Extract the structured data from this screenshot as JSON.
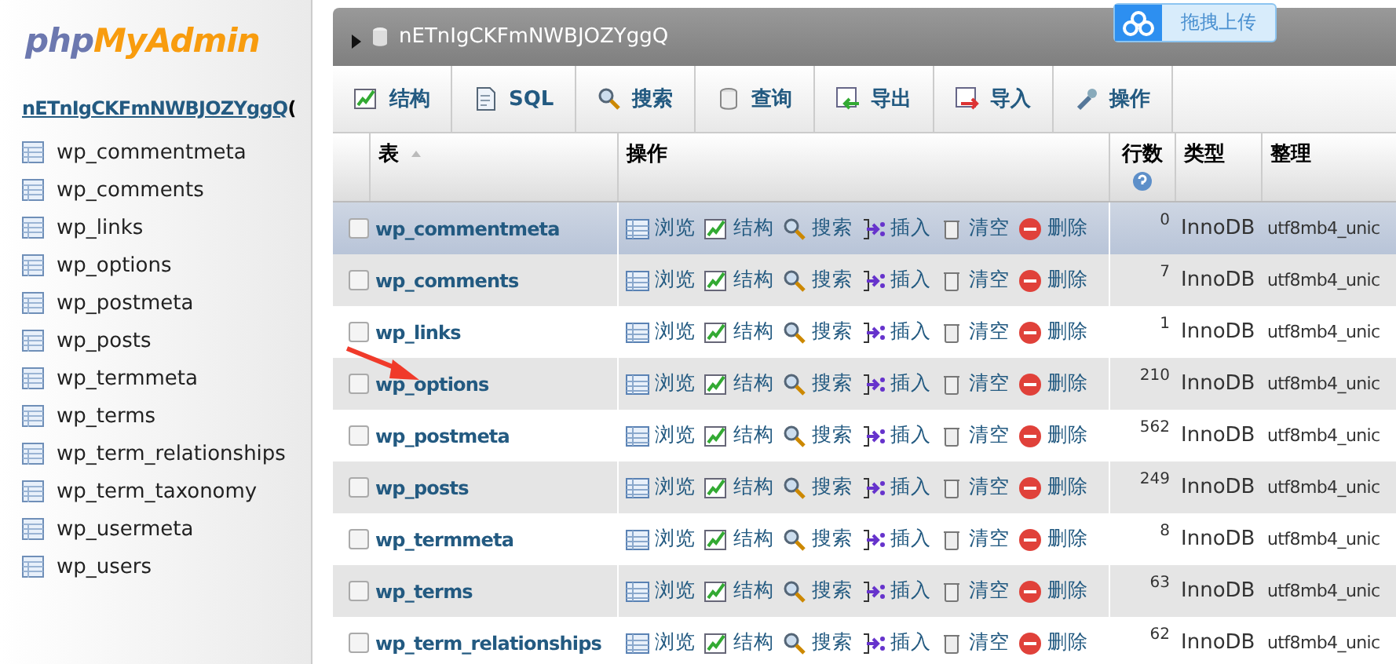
{
  "sidebar": {
    "logo": {
      "part_1": "php",
      "part_2": "MyAdmin"
    },
    "database_link": "nETnIgCKFmNWBJOZYggQ",
    "database_suffix": "(",
    "items": [
      "wp_commentmeta",
      "wp_comments",
      "wp_links",
      "wp_options",
      "wp_postmeta",
      "wp_posts",
      "wp_termmeta",
      "wp_terms",
      "wp_term_relationships",
      "wp_term_taxonomy",
      "wp_usermeta",
      "wp_users"
    ]
  },
  "breadcrumb": {
    "database": "nETnIgCKFmNWBJOZYggQ"
  },
  "upload_badge": {
    "label": "拖拽上传"
  },
  "tabs": [
    {
      "kind": "structure",
      "label": "结构"
    },
    {
      "kind": "sql",
      "label": "SQL"
    },
    {
      "kind": "search",
      "label": "搜索"
    },
    {
      "kind": "query",
      "label": "查询"
    },
    {
      "kind": "export",
      "label": "导出"
    },
    {
      "kind": "import",
      "label": "导入"
    },
    {
      "kind": "operations",
      "label": "操作"
    }
  ],
  "table": {
    "columns": [
      "表",
      "操作",
      "行数",
      "类型",
      "整理"
    ],
    "rows": [
      {
        "name": "wp_commentmeta",
        "highlighted": true,
        "checked": false,
        "actions": [
          {
            "kind": "browse",
            "label": "浏览"
          },
          {
            "kind": "structure",
            "label": "结构"
          },
          {
            "kind": "search",
            "label": "搜索"
          },
          {
            "kind": "insert",
            "label": "插入"
          },
          {
            "kind": "empty",
            "label": "清空"
          },
          {
            "kind": "drop",
            "label": "删除"
          }
        ],
        "rows": "0",
        "type": "InnoDB",
        "collation": "utf8mb4_unic"
      },
      {
        "name": "wp_comments",
        "highlighted": false,
        "checked": false,
        "actions": [
          {
            "kind": "browse",
            "label": "浏览"
          },
          {
            "kind": "structure",
            "label": "结构"
          },
          {
            "kind": "search",
            "label": "搜索"
          },
          {
            "kind": "insert",
            "label": "插入"
          },
          {
            "kind": "empty",
            "label": "清空"
          },
          {
            "kind": "drop",
            "label": "删除"
          }
        ],
        "rows": "7",
        "type": "InnoDB",
        "collation": "utf8mb4_unic"
      },
      {
        "name": "wp_links",
        "highlighted": false,
        "checked": false,
        "actions": [
          {
            "kind": "browse",
            "label": "浏览"
          },
          {
            "kind": "structure",
            "label": "结构"
          },
          {
            "kind": "search",
            "label": "搜索"
          },
          {
            "kind": "insert",
            "label": "插入"
          },
          {
            "kind": "empty",
            "label": "清空"
          },
          {
            "kind": "drop",
            "label": "删除"
          }
        ],
        "rows": "1",
        "type": "InnoDB",
        "collation": "utf8mb4_unic"
      },
      {
        "name": "wp_options",
        "highlighted": false,
        "checked": false,
        "actions": [
          {
            "kind": "browse",
            "label": "浏览"
          },
          {
            "kind": "structure",
            "label": "结构"
          },
          {
            "kind": "search",
            "label": "搜索"
          },
          {
            "kind": "insert",
            "label": "插入"
          },
          {
            "kind": "empty",
            "label": "清空"
          },
          {
            "kind": "drop",
            "label": "删除"
          }
        ],
        "rows": "210",
        "type": "InnoDB",
        "collation": "utf8mb4_unic"
      },
      {
        "name": "wp_postmeta",
        "highlighted": false,
        "checked": false,
        "actions": [
          {
            "kind": "browse",
            "label": "浏览"
          },
          {
            "kind": "structure",
            "label": "结构"
          },
          {
            "kind": "search",
            "label": "搜索"
          },
          {
            "kind": "insert",
            "label": "插入"
          },
          {
            "kind": "empty",
            "label": "清空"
          },
          {
            "kind": "drop",
            "label": "删除"
          }
        ],
        "rows": "562",
        "type": "InnoDB",
        "collation": "utf8mb4_unic"
      },
      {
        "name": "wp_posts",
        "highlighted": false,
        "checked": false,
        "actions": [
          {
            "kind": "browse",
            "label": "浏览"
          },
          {
            "kind": "structure",
            "label": "结构"
          },
          {
            "kind": "search",
            "label": "搜索"
          },
          {
            "kind": "insert",
            "label": "插入"
          },
          {
            "kind": "empty",
            "label": "清空"
          },
          {
            "kind": "drop",
            "label": "删除"
          }
        ],
        "rows": "249",
        "type": "InnoDB",
        "collation": "utf8mb4_unic"
      },
      {
        "name": "wp_termmeta",
        "highlighted": false,
        "checked": false,
        "actions": [
          {
            "kind": "browse",
            "label": "浏览"
          },
          {
            "kind": "structure",
            "label": "结构"
          },
          {
            "kind": "search",
            "label": "搜索"
          },
          {
            "kind": "insert",
            "label": "插入"
          },
          {
            "kind": "empty",
            "label": "清空"
          },
          {
            "kind": "drop",
            "label": "删除"
          }
        ],
        "rows": "8",
        "type": "InnoDB",
        "collation": "utf8mb4_unic"
      },
      {
        "name": "wp_terms",
        "highlighted": false,
        "checked": false,
        "actions": [
          {
            "kind": "browse",
            "label": "浏览"
          },
          {
            "kind": "structure",
            "label": "结构"
          },
          {
            "kind": "search",
            "label": "搜索"
          },
          {
            "kind": "insert",
            "label": "插入"
          },
          {
            "kind": "empty",
            "label": "清空"
          },
          {
            "kind": "drop",
            "label": "删除"
          }
        ],
        "rows": "63",
        "type": "InnoDB",
        "collation": "utf8mb4_unic"
      },
      {
        "name": "wp_term_relationships",
        "highlighted": false,
        "checked": false,
        "actions": [
          {
            "kind": "browse",
            "label": "浏览"
          },
          {
            "kind": "structure",
            "label": "结构"
          },
          {
            "kind": "search",
            "label": "搜索"
          },
          {
            "kind": "insert",
            "label": "插入"
          },
          {
            "kind": "empty",
            "label": "清空"
          },
          {
            "kind": "drop",
            "label": "删除"
          }
        ],
        "rows": "62",
        "type": "InnoDB",
        "collation": "utf8mb4_unic"
      }
    ]
  },
  "annotation": {
    "kind": "arrow"
  }
}
